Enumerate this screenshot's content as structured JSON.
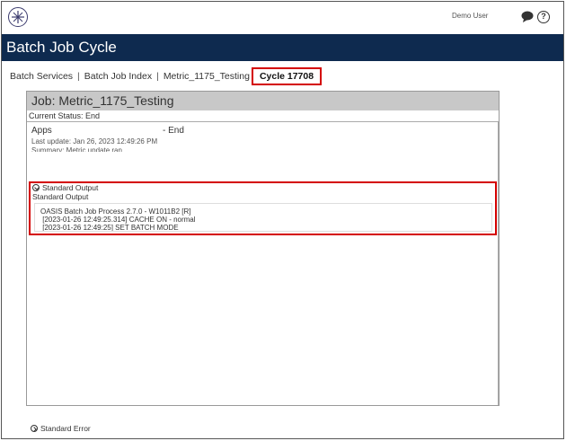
{
  "header": {
    "logo_icon": "compass-logo-icon",
    "user_name": "Demo User",
    "chat_icon": "chat-bubble-icon",
    "help_icon": "help-circle-icon",
    "help_glyph": "?"
  },
  "title": "Batch Job Cycle",
  "breadcrumb": {
    "items": [
      "Batch Services",
      "Batch Job Index",
      "Metric_1175_Testing"
    ],
    "separator": "|",
    "current": "Cycle 17708"
  },
  "job": {
    "title": "Job: Metric_1175_Testing",
    "current_status": "Current Status: End",
    "apps_label": "Apps",
    "apps_status": "- End",
    "last_update": "Last update: Jan 26, 2023 12:49:26 PM",
    "summary": "Summary: Metric update ran",
    "standard_output_toggle": "Standard Output",
    "standard_output_label": "Standard Output",
    "log_lines": [
      "OASIS Batch Job Process 2.7.0 - W1011B2 [R]",
      " [2023-01-26 12:49:25.314] CACHE ON - normal",
      " [2023-01-26 12:49:25] SET BATCH MODE"
    ],
    "standard_error_toggle": "Standard Error"
  },
  "colors": {
    "titlebar": "#0e2a4f",
    "highlight": "#d40000",
    "panel_header": "#c8c8c8"
  }
}
